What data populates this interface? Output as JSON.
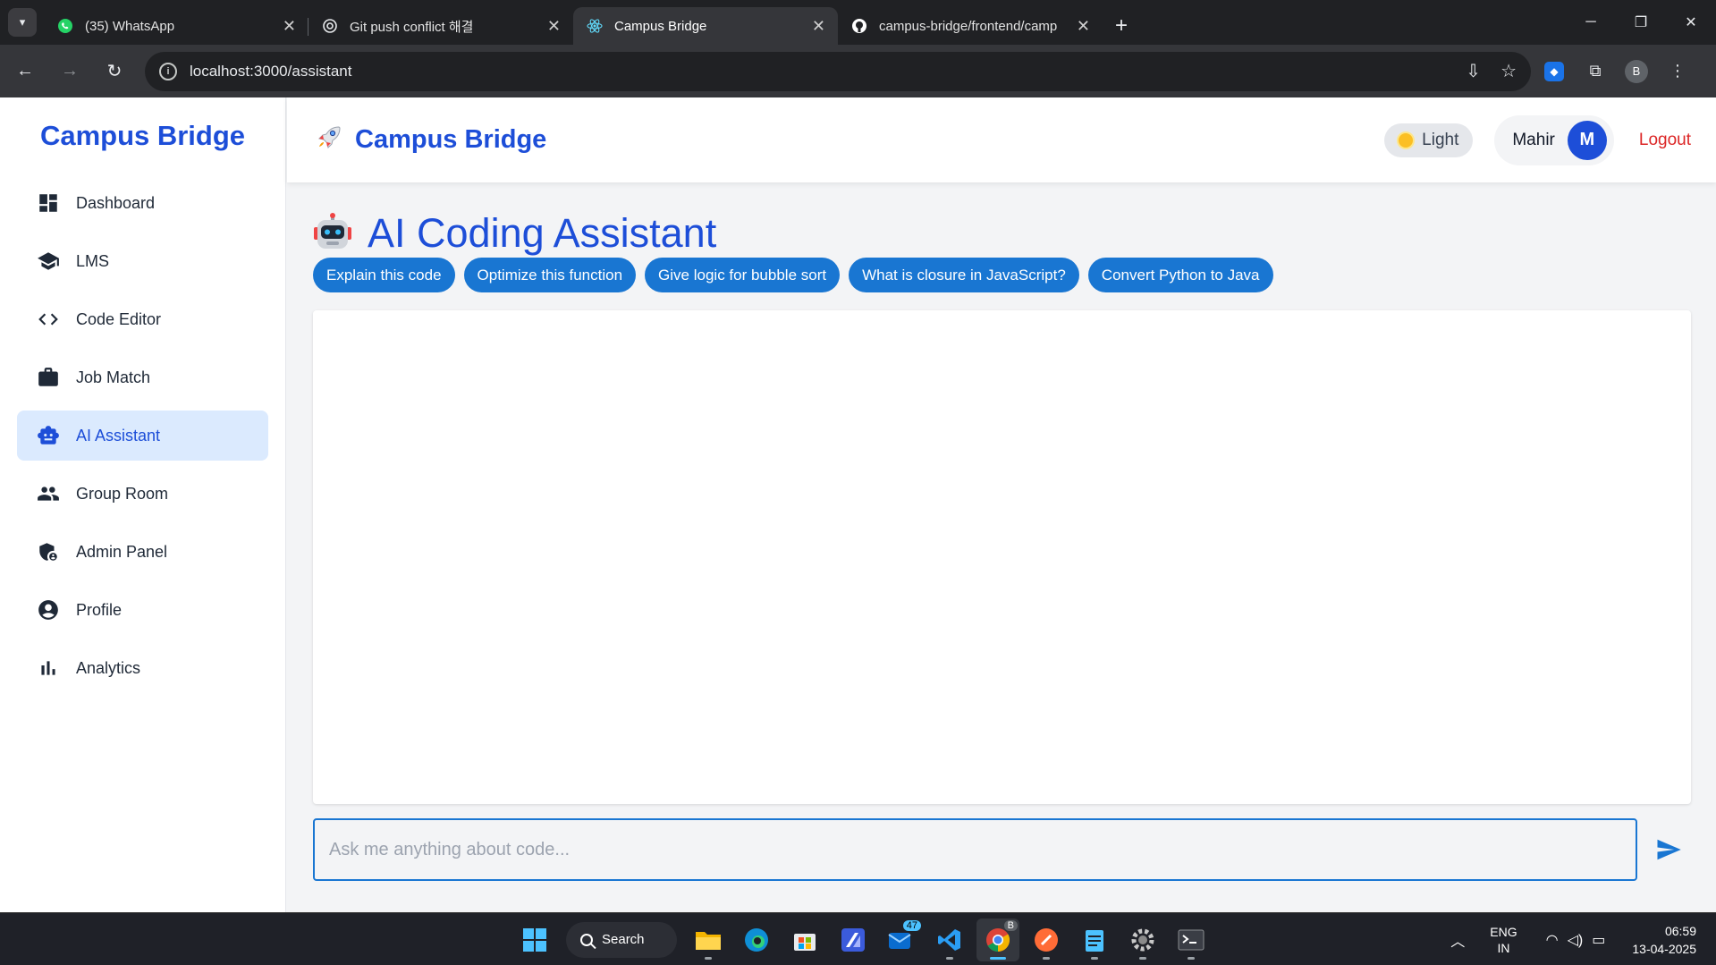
{
  "browser": {
    "tabs": [
      {
        "title": "(35) WhatsApp",
        "icon": "whatsapp-icon"
      },
      {
        "title": "Git push conflict 해결",
        "icon": "openai-icon"
      },
      {
        "title": "Campus Bridge",
        "icon": "react-icon",
        "active": true
      },
      {
        "title": "campus-bridge/frontend/camp",
        "icon": "github-icon"
      }
    ],
    "url": "localhost:3000/assistant",
    "profile_initial": "B"
  },
  "sidebar": {
    "brand": "Campus Bridge",
    "items": [
      {
        "label": "Dashboard",
        "icon": "dashboard-icon"
      },
      {
        "label": "LMS",
        "icon": "school-icon"
      },
      {
        "label": "Code Editor",
        "icon": "code-icon"
      },
      {
        "label": "Job Match",
        "icon": "briefcase-icon"
      },
      {
        "label": "AI Assistant",
        "icon": "robot-icon",
        "active": true
      },
      {
        "label": "Group Room",
        "icon": "group-icon"
      },
      {
        "label": "Admin Panel",
        "icon": "admin-shield-icon"
      },
      {
        "label": "Profile",
        "icon": "account-circle-icon"
      },
      {
        "label": "Analytics",
        "icon": "bar-chart-icon"
      }
    ]
  },
  "header": {
    "title": "Campus Bridge",
    "theme_label": "Light",
    "user_name": "Mahir",
    "user_initial": "M",
    "logout_label": "Logout"
  },
  "assistant": {
    "title": "AI Coding Assistant",
    "suggestions": [
      "Explain this code",
      "Optimize this function",
      "Give logic for bubble sort",
      "What is closure in JavaScript?",
      "Convert Python to Java"
    ],
    "input_placeholder": "Ask me anything about code..."
  },
  "taskbar": {
    "search_label": "Search",
    "lang_line1": "ENG",
    "lang_line2": "IN",
    "time": "06:59",
    "date": "13-04-2025",
    "mail_badge": "47",
    "chrome_badge": "B"
  },
  "colors": {
    "accent": "#1d4ed8",
    "chip": "#1976d2",
    "logout": "#dc2626",
    "active_nav_bg": "#dbeafe"
  }
}
